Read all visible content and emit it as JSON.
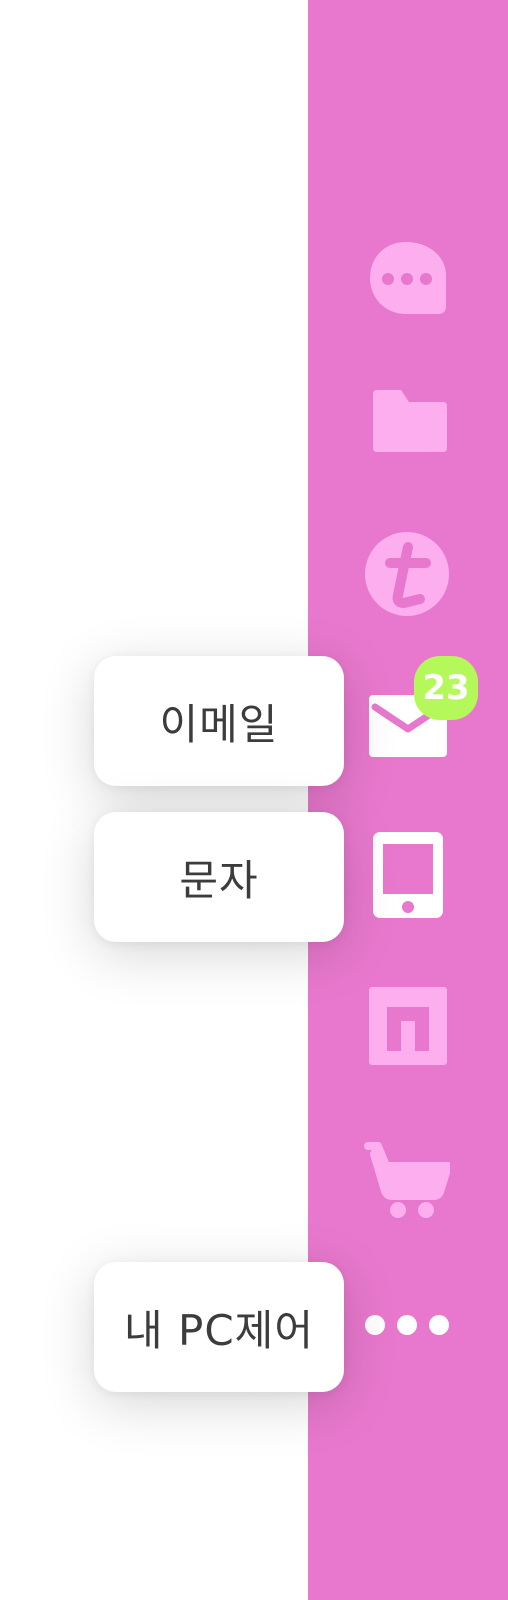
{
  "colors": {
    "sidebar_bg": "#e878cd",
    "icon_inactive": "#fcaeef",
    "icon_active": "#ffffff",
    "badge_bg": "#b5f85a",
    "tooltip_text": "#3c3c3c"
  },
  "sidebar": {
    "items": [
      {
        "id": "chat",
        "icon": "chat-bubble-icon",
        "active": false
      },
      {
        "id": "files",
        "icon": "folder-icon",
        "active": false
      },
      {
        "id": "tistory",
        "icon": "tistory-icon",
        "active": false
      },
      {
        "id": "email",
        "icon": "mail-icon",
        "active": true,
        "tooltip": "이메일",
        "badge": "23"
      },
      {
        "id": "sms",
        "icon": "phone-icon",
        "active": true,
        "tooltip": "문자"
      },
      {
        "id": "naver",
        "icon": "n-logo-icon",
        "active": false
      },
      {
        "id": "shop",
        "icon": "cart-icon",
        "active": false
      },
      {
        "id": "more",
        "icon": "more-dots-icon",
        "active": true,
        "tooltip": "내 PC제어"
      }
    ]
  }
}
